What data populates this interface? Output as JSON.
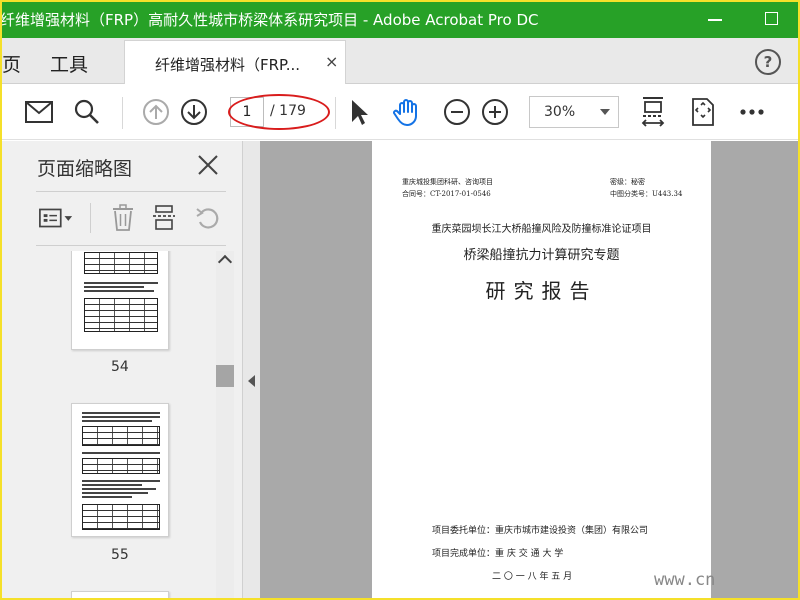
{
  "window": {
    "title": "纤维增强材料（FRP）高耐久性城市桥梁体系研究项目 - Adobe Acrobat Pro DC"
  },
  "tabbar": {
    "home_partial": "页",
    "tools": "工具",
    "doc_tab": "纤维增强材料（FRP...",
    "close_glyph": "×",
    "help_glyph": "?"
  },
  "toolbar": {
    "current_page": "1",
    "total_pages": "/ 179",
    "zoom": "30%"
  },
  "panel": {
    "title": "页面缩略图",
    "thumbnails": [
      {
        "label": "54"
      },
      {
        "label": "55"
      }
    ]
  },
  "document": {
    "org": "重庆城投集团科研、咨询项目",
    "contract": "合同号：CT-2017-01-0546",
    "secret": "密级：秘密",
    "class_no": "中图分类号：U443.34",
    "project_title": "重庆菜园坝长江大桥船撞风险及防撞标准论证项目",
    "subtitle": "桥梁船撞抗力计算研究专题",
    "report_title": "研究报告",
    "commission": "项目委托单位：重庆市城市建设投资（集团）有限公司",
    "completion": "项目完成单位：重 庆 交 通 大 学",
    "date": "二 〇 一 八 年 五 月"
  },
  "watermark": "www.cn",
  "colors": {
    "titlebar": "#27a127",
    "annotation": "#d91c1c",
    "frame": "#f5e02a"
  }
}
